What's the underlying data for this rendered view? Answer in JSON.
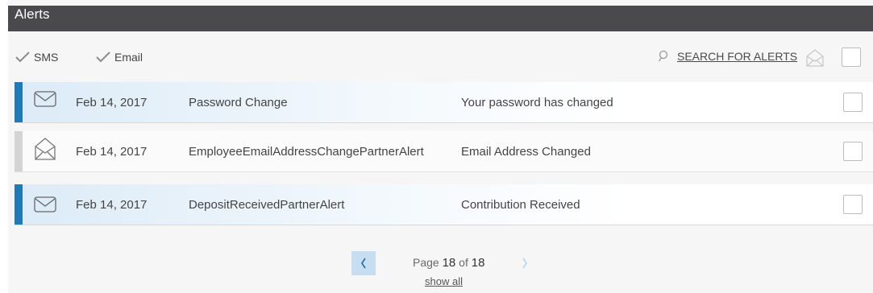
{
  "header": {
    "title": "Alerts"
  },
  "filters": {
    "sms_label": "SMS",
    "email_label": "Email",
    "search_label": "SEARCH FOR ALERTS"
  },
  "alerts": [
    {
      "date": "Feb 14, 2017",
      "name": "Password Change",
      "message": "Your password has changed",
      "status": "unread",
      "icon": "envelope-closed-icon"
    },
    {
      "date": "Feb 14, 2017",
      "name": "EmployeeEmailAddressChangePartnerAlert",
      "message": "Email Address Changed",
      "status": "read",
      "icon": "envelope-open-icon"
    },
    {
      "date": "Feb 14, 2017",
      "name": "DepositReceivedPartnerAlert",
      "message": "Contribution Received",
      "status": "unread",
      "icon": "envelope-closed-icon"
    }
  ],
  "pagination": {
    "page_label": "Page",
    "current": "18",
    "of_label": "of",
    "total": "18",
    "show_all": "show all"
  },
  "colors": {
    "header_bg": "#4a4a4c",
    "unread_accent": "#1f7ab8",
    "read_accent": "#d4d4d4",
    "prev_button_bg": "#c6def0"
  }
}
